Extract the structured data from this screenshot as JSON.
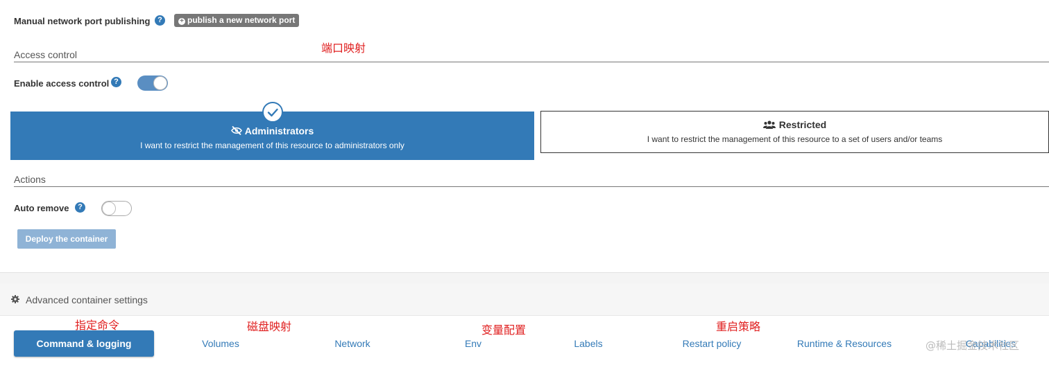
{
  "ports": {
    "label": "Manual network port publishing",
    "help_glyph": "?",
    "publish_button": "publish a new network port"
  },
  "access_control": {
    "section_title": "Access control",
    "enable_label": "Enable access control",
    "help_glyph": "?",
    "enabled": true,
    "administrators": {
      "title": "Administrators",
      "description": "I want to restrict the management of this resource to administrators only",
      "selected": true
    },
    "restricted": {
      "title": "Restricted",
      "description": "I want to restrict the management of this resource to a set of users and/or teams",
      "selected": false
    }
  },
  "actions": {
    "section_title": "Actions",
    "auto_remove_label": "Auto remove",
    "help_glyph": "?",
    "auto_remove": false,
    "deploy_button": "Deploy the container"
  },
  "advanced": {
    "title": "Advanced container settings",
    "icon": "gear-icon",
    "tabs": [
      {
        "label": "Command & logging",
        "active": true
      },
      {
        "label": "Volumes",
        "active": false
      },
      {
        "label": "Network",
        "active": false
      },
      {
        "label": "Env",
        "active": false
      },
      {
        "label": "Labels",
        "active": false
      },
      {
        "label": "Restart policy",
        "active": false
      },
      {
        "label": "Runtime & Resources",
        "active": false
      },
      {
        "label": "Capabilities",
        "active": false
      }
    ]
  },
  "annotations": {
    "port_mapping": "端口映射",
    "command": "指定命令",
    "volume_mapping": "磁盘映射",
    "env_config": "变量配置",
    "restart_policy": "重启策略"
  },
  "watermark": "@稀土掘金技术社区",
  "colors": {
    "primary": "#337ab7",
    "toggle_on": "#5a8ec2",
    "deploy_disabled": "#8fb3d6",
    "publish_button": "#777777",
    "annotation": "#e02020"
  }
}
